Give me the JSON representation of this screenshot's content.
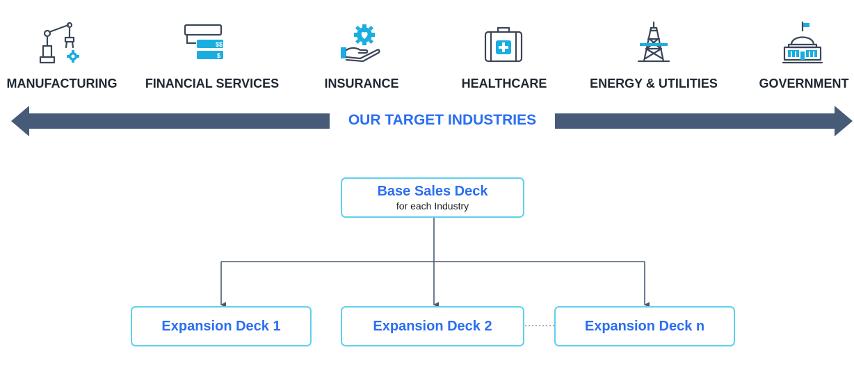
{
  "industries": [
    {
      "label": "MANUFACTURING",
      "icon": "robot-arm-icon"
    },
    {
      "label": "FINANCIAL SERVICES",
      "icon": "finance-dollar-cards-icon"
    },
    {
      "label": "INSURANCE",
      "icon": "hand-heart-gear-icon"
    },
    {
      "label": "HEALTHCARE",
      "icon": "medical-bag-icon"
    },
    {
      "label": "ENERGY & UTILITIES",
      "icon": "oil-rig-icon"
    },
    {
      "label": "GOVERNMENT",
      "icon": "capitol-building-icon"
    }
  ],
  "arrow": {
    "label": "OUR TARGET INDUSTRIES"
  },
  "hierarchy": {
    "base": {
      "title": "Base Sales Deck",
      "subtitle": "for each Industry"
    },
    "expansions": [
      {
        "label": "Expansion Deck 1"
      },
      {
        "label": "Expansion Deck 2"
      },
      {
        "label": "Expansion Deck n"
      }
    ]
  },
  "colors": {
    "icon_stroke": "#3a4658",
    "icon_accent": "#1aaee0",
    "arrow_fill": "#475a78",
    "label_text": "#1f2733",
    "accent_text": "#2b6ef2",
    "box_border": "#5fd0f0",
    "connector": "#4a5a75"
  }
}
